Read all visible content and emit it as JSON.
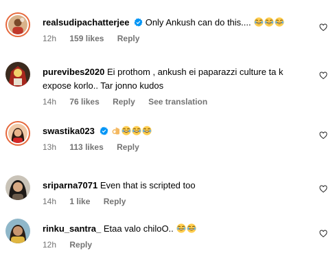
{
  "comments": [
    {
      "username": "realsudipachatterjee",
      "verified": true,
      "text": "Only Ankush can do this....",
      "emojis": [
        "laughing-face",
        "laughing-face",
        "laughing-face"
      ],
      "time": "12h",
      "likes": "159 likes",
      "reply_label": "Reply"
    },
    {
      "username": "purevibes2020",
      "verified": false,
      "text_line1": "Ei prothom , ankush ei paparazzi culture ta k",
      "text_line2": "expose korlo.. Tar jonno kudos",
      "time": "14h",
      "likes": "76 likes",
      "reply_label": "Reply",
      "translation_label": "See translation"
    },
    {
      "username": "swastika023",
      "verified": true,
      "text": "",
      "emojis": [
        "ok-hand",
        "laughing-face",
        "laughing-face",
        "laughing-face"
      ],
      "time": "13h",
      "likes": "113 likes",
      "reply_label": "Reply"
    },
    {
      "username": "sriparna7071",
      "verified": false,
      "text": "Even that is scripted too",
      "time": "14h",
      "likes": "1 like",
      "reply_label": "Reply"
    },
    {
      "username": "rinku_santra_",
      "verified": false,
      "text": "Etaa valo chiloO..",
      "emojis": [
        "laughing-face",
        "laughing-face"
      ],
      "time": "12h",
      "reply_label": "Reply"
    }
  ],
  "colors": {
    "verified": "#0095f6",
    "meta_text": "#737373",
    "story_ring": "#e6683c",
    "emoji_yellow": "#ffcc4d"
  }
}
